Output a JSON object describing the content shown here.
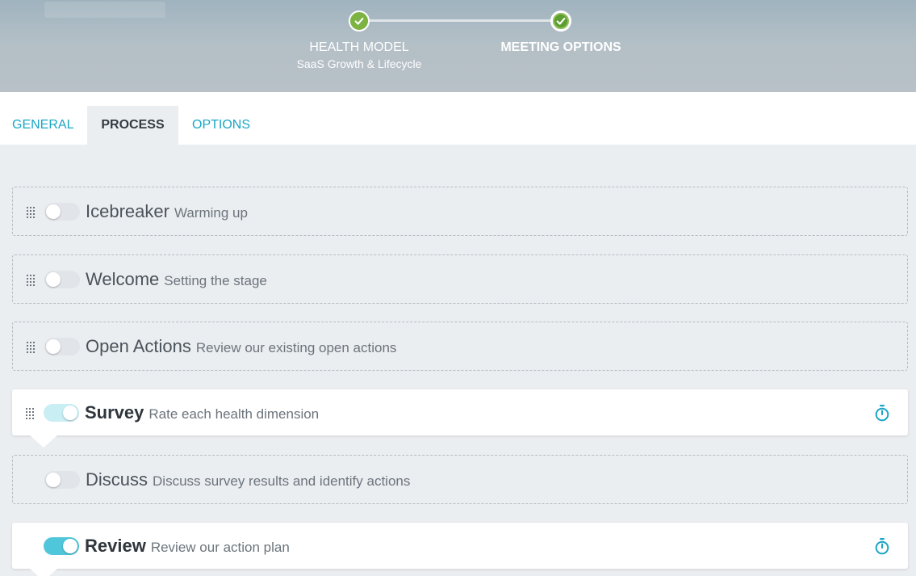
{
  "stepper": {
    "steps": [
      {
        "title": "HEALTH MODEL",
        "subtitle": "SaaS Growth & Lifecycle"
      },
      {
        "title": "MEETING OPTIONS"
      }
    ]
  },
  "tabs": [
    {
      "label": "GENERAL"
    },
    {
      "label": "PROCESS",
      "active": true
    },
    {
      "label": "OPTIONS"
    }
  ],
  "process": {
    "items": [
      {
        "title": "Icebreaker",
        "description": "Warming up",
        "enabled": false
      },
      {
        "title": "Welcome",
        "description": "Setting the stage",
        "enabled": false
      },
      {
        "title": "Open Actions",
        "description": "Review our existing open actions",
        "enabled": false
      },
      {
        "title": "Survey",
        "description": "Rate each health dimension",
        "enabled": true
      },
      {
        "title": "Discuss",
        "description": "Discuss survey results and identify actions",
        "enabled": false
      },
      {
        "title": "Review",
        "description": "Review our action plan",
        "enabled": true
      }
    ]
  },
  "colors": {
    "accent": "#1aa6c4",
    "step_complete": "#7cb342",
    "toggle_on": "#4fc6d9"
  }
}
